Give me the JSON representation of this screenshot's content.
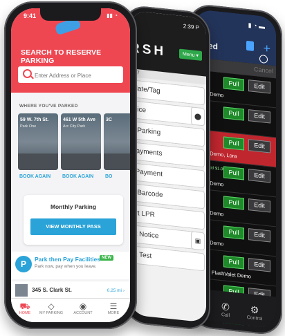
{
  "front": {
    "status_time": "9:41",
    "title": "SEARCH TO RESERVE PARKING",
    "search_placeholder": "Enter Address or Place",
    "section_label": "WHERE YOU'VE PARKED",
    "cards": [
      {
        "address": "59 W. 7th St.",
        "facility": "Park One",
        "action": "BOOK AGAIN"
      },
      {
        "address": "461 W 5th Ave",
        "facility": "Arc City Park",
        "action": "BOOK AGAIN"
      },
      {
        "address": "3C",
        "facility": "",
        "action": "BO"
      }
    ],
    "monthly_title": "Monthly Parking",
    "monthly_button": "VIEW MONTHLY PASS",
    "park_pay_title": "Park then Pay Facilities",
    "park_pay_badge": "NEW",
    "park_pay_subtitle": "Park now, pay when you leave.",
    "facility_name": "345 S. Clark St.",
    "facility_distance": "0.25 mi",
    "nav": [
      "HOME",
      "MY PARKING",
      "ACCOUNT",
      "MORE"
    ]
  },
  "middle": {
    "status_time": "2:39 P",
    "logo": "RSH",
    "menu_button": "Menu",
    "sub_label": "007",
    "items": [
      "Plate/Tag",
      "otice",
      "d Parking",
      "Payments",
      "t Payment",
      "n Barcode",
      "art LPR",
      "nt Notice",
      "nt Test"
    ]
  },
  "back": {
    "title": "sued",
    "search_cancel": "Cancel",
    "pull_label": "Pull",
    "edit_label": "Edit",
    "paid_label": "Paid $1.00",
    "rows": [
      {
        "label": "lValet Demo",
        "highlight": false
      },
      {
        "label": "",
        "highlight": false
      },
      {
        "label": "lValet Demo, Lora",
        "highlight": true
      },
      {
        "label": "lValet Demo",
        "highlight": false
      },
      {
        "label": "lValet Demo",
        "highlight": false
      },
      {
        "label": "lValet Demo",
        "highlight": false
      },
      {
        "label": "o, Lot: FlashValet Demo",
        "highlight": false
      },
      {
        "label": "lValet Demo",
        "highlight": false
      },
      {
        "label": "lValet Demo",
        "highlight": false
      }
    ],
    "tabs": [
      "ction",
      "Call",
      "Control"
    ]
  }
}
